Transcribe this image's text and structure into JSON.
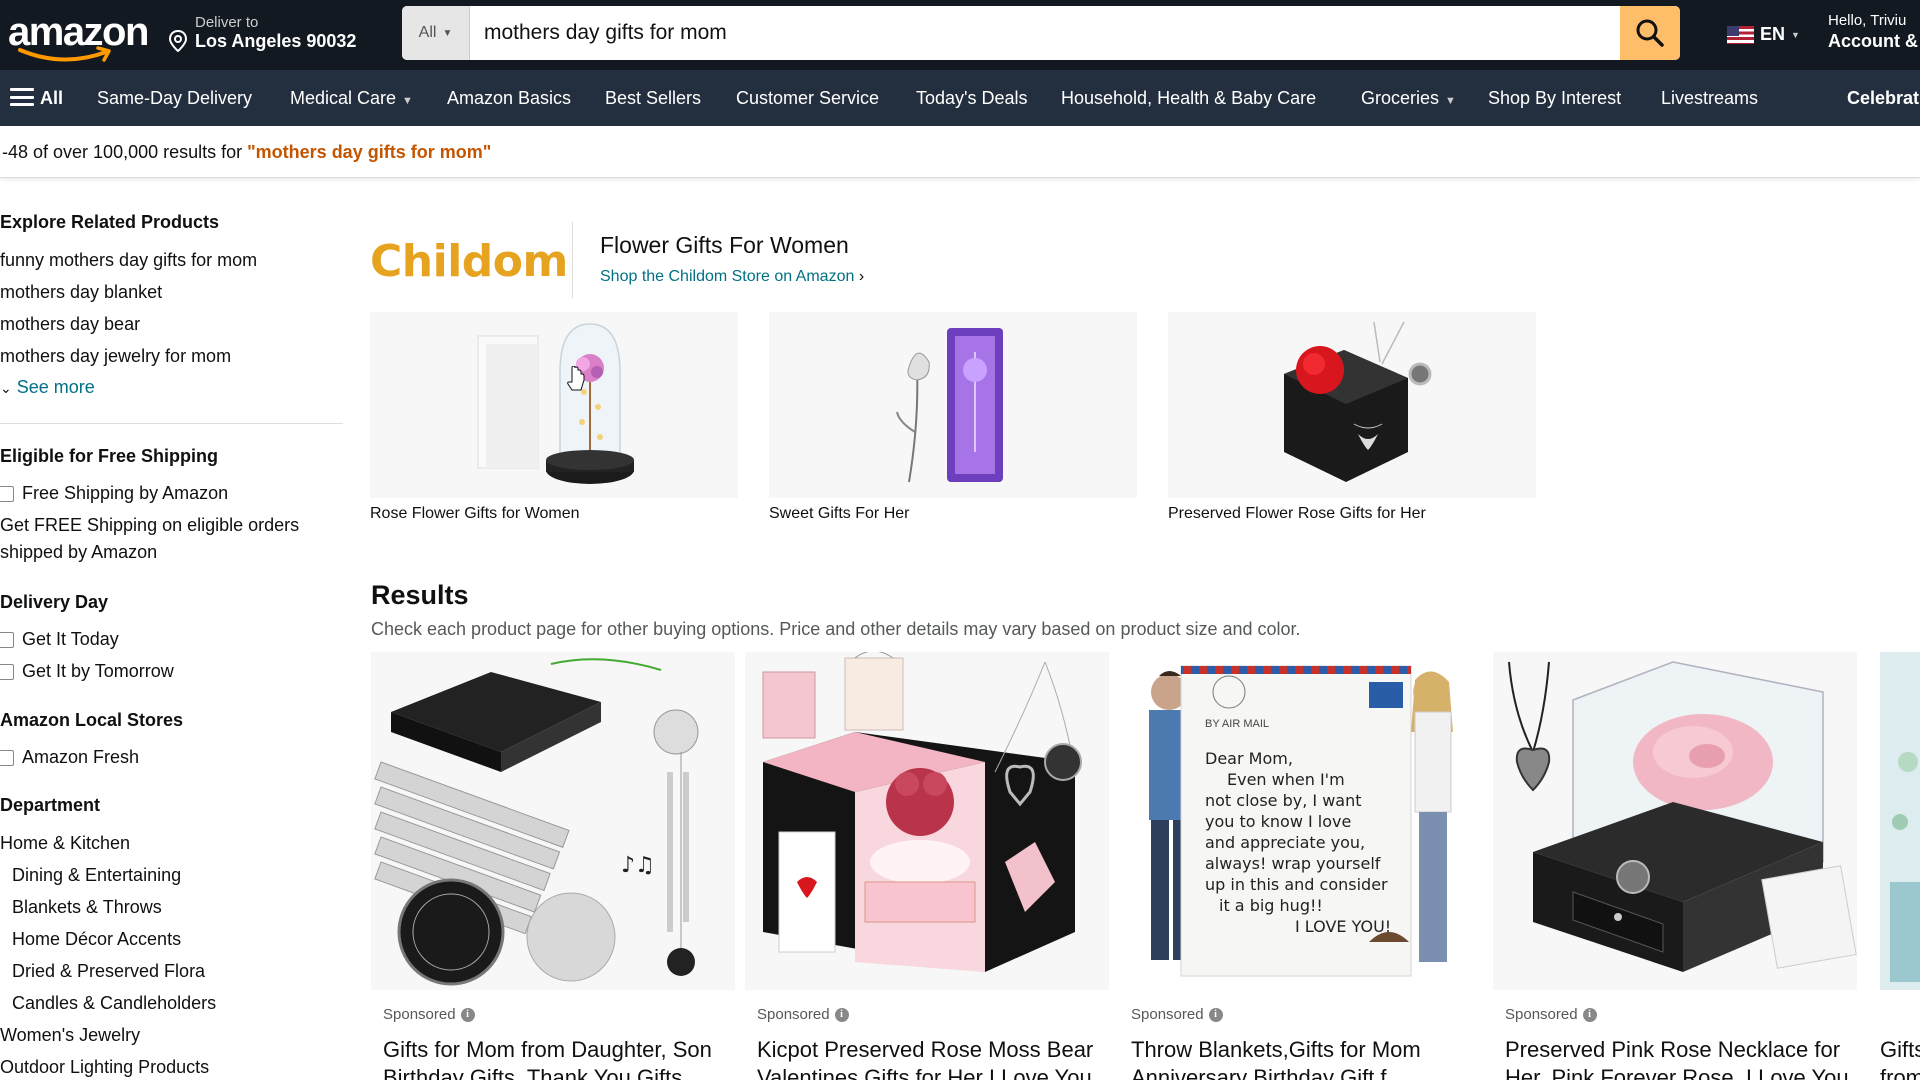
{
  "header": {
    "logo_text": "amazon",
    "deliver_line1": "Deliver to",
    "deliver_line2": "Los Angeles 90032",
    "search_category": "All",
    "search_value": "mothers day gifts for mom",
    "language": "EN",
    "account_line1": "Hello, Triviu",
    "account_line2": "Account &"
  },
  "subnav": {
    "all": "All",
    "items": [
      "Same-Day Delivery",
      "Medical Care",
      "Amazon Basics",
      "Best Sellers",
      "Customer Service",
      "Today's Deals",
      "Household, Health & Baby Care",
      "Groceries",
      "Shop By Interest",
      "Livestreams",
      "Celebrat"
    ]
  },
  "results_bar": {
    "prefix": "-48 of over 100,000 results for ",
    "query": "\"mothers day gifts for mom\""
  },
  "sidebar": {
    "related_heading": "Explore Related Products",
    "related": [
      "funny mothers day gifts for mom",
      "mothers day blanket",
      "mothers day bear",
      "mothers day jewelry for mom"
    ],
    "see_more": "See more",
    "shipping_heading": "Eligible for Free Shipping",
    "shipping_option": "Free Shipping by Amazon",
    "shipping_note": "Get FREE Shipping on eligible orders shipped by Amazon",
    "delivery_heading": "Delivery Day",
    "delivery_options": [
      "Get It Today",
      "Get It by Tomorrow"
    ],
    "local_heading": "Amazon Local Stores",
    "local_option": "Amazon Fresh",
    "dept_heading": "Department",
    "dept_items": [
      "Home & Kitchen",
      "Dining & Entertaining",
      "Blankets & Throws",
      "Home Décor Accents",
      "Dried & Preserved Flora",
      "Candles & Candleholders",
      "Women's Jewelry",
      "Outdoor Lighting Products"
    ]
  },
  "brand": {
    "logo": "Childom",
    "title": "Flower Gifts For Women",
    "link": "Shop the Childom Store on Amazon",
    "tiles": [
      "Rose Flower Gifts for Women",
      "Sweet Gifts For Her",
      "Preserved Flower Rose Gifts for Her"
    ]
  },
  "results": {
    "title": "Results",
    "subtitle": "Check each product page for other buying options. Price and other details may vary based on product size and color.",
    "sponsored_label": "Sponsored",
    "products": [
      {
        "title": "Gifts for Mom from Daughter, Son Birthday Gifts, Thank You Gifts"
      },
      {
        "title": "Kicpot Preserved Rose Moss Bear Valentines Gifts for Her I Love You"
      },
      {
        "title": "Throw Blankets,Gifts for Mom Anniversary Birthday Gift f"
      },
      {
        "title": "Preserved Pink Rose Necklace for Her, Pink Forever Rose, I Love You"
      },
      {
        "title": "Gifts from"
      }
    ],
    "blanket_text": [
      "Dear Mom,",
      "Even when I'm",
      "not close by, I want",
      "you to know I love",
      "and appreciate you,",
      "always! wrap yourself",
      "up in this and consider",
      "it a big hug!!",
      "I LOVE YOU!"
    ],
    "air_mail": "BY AIR MAIL"
  },
  "colors": {
    "nav_top": "#131921",
    "nav_sub": "#232f3e",
    "search_button": "#febd69",
    "link": "#007185",
    "query": "#c45500",
    "brand_logo": "#e5a320"
  }
}
